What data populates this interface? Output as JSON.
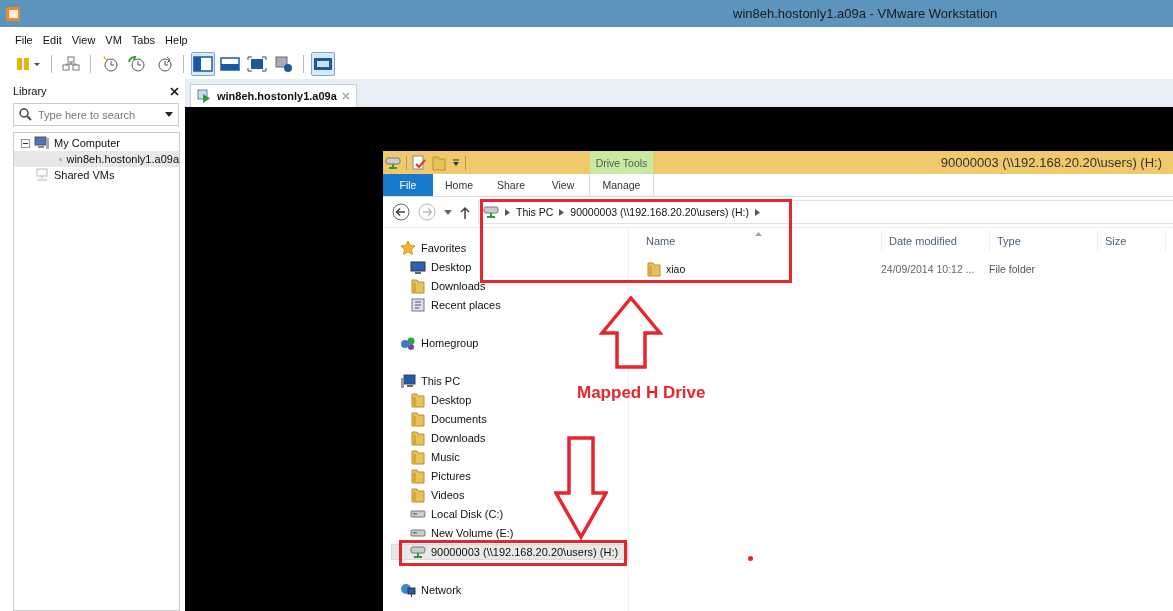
{
  "window": {
    "title": "win8eh.hostonly1.a09a - VMware Workstation"
  },
  "menu": [
    "File",
    "Edit",
    "View",
    "VM",
    "Tabs",
    "Help"
  ],
  "toolbar": [
    {
      "kind": "pause",
      "pressed": false
    },
    {
      "kind": "separator"
    },
    {
      "kind": "network",
      "pressed": false
    },
    {
      "kind": "separator"
    },
    {
      "kind": "snapshot",
      "pressed": false
    },
    {
      "kind": "revert",
      "pressed": false
    },
    {
      "kind": "manager",
      "pressed": false
    },
    {
      "kind": "separator"
    },
    {
      "kind": "console",
      "pressed": true
    },
    {
      "kind": "quick",
      "pressed": false
    },
    {
      "kind": "fullscreen",
      "pressed": false
    },
    {
      "kind": "unity",
      "pressed": false
    },
    {
      "kind": "separator"
    },
    {
      "kind": "thumbnail",
      "pressed": true
    }
  ],
  "library": {
    "title": "Library",
    "search": {
      "placeholder": "Type here to search"
    },
    "tree": [
      {
        "label": "My Computer",
        "kind": "computer",
        "expanded": true,
        "selected": false,
        "children": [
          {
            "label": "win8eh.hostonly1.a09a",
            "selected": true
          }
        ]
      },
      {
        "label": "Shared VMs",
        "kind": "shared",
        "selected": false
      }
    ]
  },
  "tabs": [
    {
      "label": "win8eh.hostonly1.a09a",
      "selected": true
    }
  ],
  "explorer": {
    "title": "90000003 (\\\\192.168.20.20\\users) (H:)",
    "context_group": "Drive Tools",
    "ribbon_tabs": [
      {
        "label": "File",
        "kind": "file",
        "selected": false
      },
      {
        "label": "Home",
        "kind": "tab",
        "selected": false
      },
      {
        "label": "Share",
        "kind": "tab",
        "selected": false
      },
      {
        "label": "View",
        "kind": "tab",
        "selected": false
      },
      {
        "label": "Manage",
        "kind": "context",
        "selected": false
      }
    ],
    "address": [
      "This PC",
      "90000003 (\\\\192.168.20.20\\users) (H:)"
    ],
    "nav": [
      {
        "label": "Favorites",
        "kind": "star",
        "selected": false,
        "children": [
          {
            "label": "Desktop",
            "kind": "monitor",
            "selected": false
          },
          {
            "label": "Downloads",
            "kind": "folder",
            "selected": false
          },
          {
            "label": "Recent places",
            "kind": "recent",
            "selected": false
          }
        ]
      },
      {
        "label": "Homegroup",
        "kind": "homegroup",
        "selected": false
      },
      {
        "label": "This PC",
        "kind": "pc",
        "selected": false,
        "children": [
          {
            "label": "Desktop",
            "kind": "folder",
            "selected": false
          },
          {
            "label": "Documents",
            "kind": "folder",
            "selected": false
          },
          {
            "label": "Downloads",
            "kind": "folder",
            "selected": false
          },
          {
            "label": "Music",
            "kind": "folder",
            "selected": false
          },
          {
            "label": "Pictures",
            "kind": "folder",
            "selected": false
          },
          {
            "label": "Videos",
            "kind": "folder",
            "selected": false
          },
          {
            "label": "Local Disk (C:)",
            "kind": "disk",
            "selected": false
          },
          {
            "label": "New Volume (E:)",
            "kind": "disk",
            "selected": false
          },
          {
            "label": "90000003 (\\\\192.168.20.20\\users) (H:)",
            "kind": "netdrive",
            "selected": true
          }
        ]
      },
      {
        "label": "Network",
        "kind": "network",
        "selected": false
      }
    ],
    "columns": [
      {
        "label": "Name",
        "sorted": true
      },
      {
        "label": "Date modified",
        "sorted": false
      },
      {
        "label": "Type",
        "sorted": false
      },
      {
        "label": "Size",
        "sorted": false
      }
    ],
    "rows": [
      {
        "name": "xiao",
        "date_modified": "24/09/2014 10:12 ...",
        "type": "File folder"
      }
    ]
  },
  "annotation": {
    "label": "Mapped H Drive"
  }
}
